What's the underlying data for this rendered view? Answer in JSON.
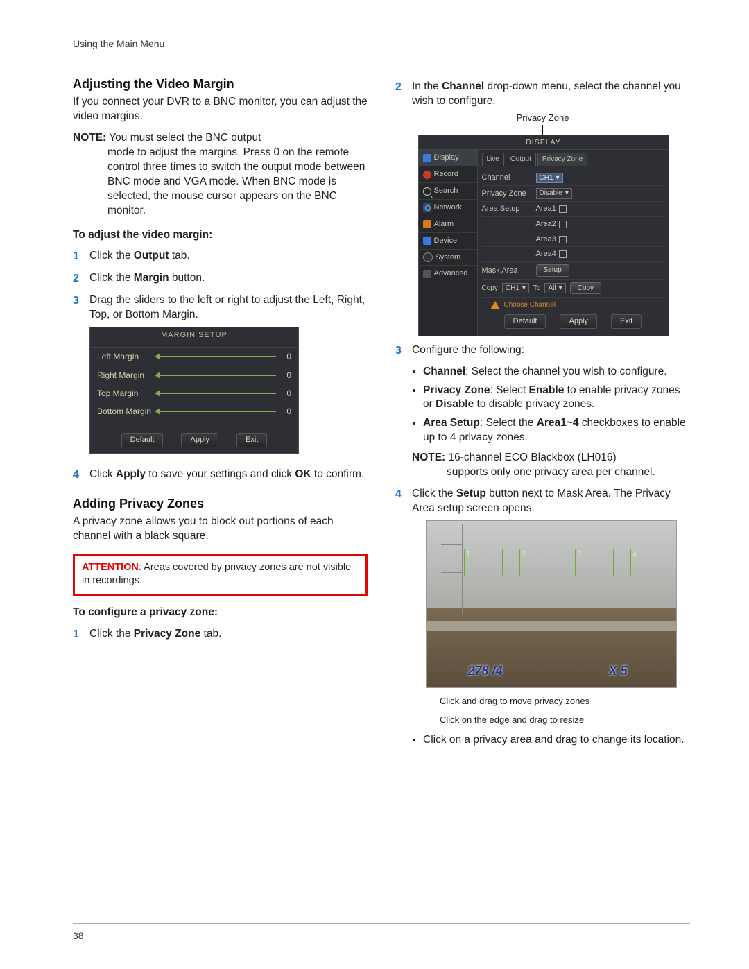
{
  "header": "Using the Main Menu",
  "page_number": "38",
  "left": {
    "h1": "Adjusting the Video Margin",
    "p1": "If you connect your DVR to a BNC monitor, you can adjust the video margins.",
    "note_label": "NOTE:",
    "note_first": " You must select the BNC output",
    "note_rest": "mode to adjust the margins. Press 0 on the remote control three times to switch the output mode between BNC mode and VGA mode. When BNC mode is selected, the mouse cursor appears on the BNC monitor.",
    "sub1": "To adjust the video margin:",
    "s1_a": "Click the ",
    "s1_b": "Output",
    "s1_c": " tab.",
    "s2_a": "Click the ",
    "s2_b": "Margin",
    "s2_c": " button.",
    "s3": "Drag the sliders to the left or right to adjust the Left, Right, Top, or Bottom Margin.",
    "margin_ui": {
      "title": "MARGIN SETUP",
      "rows": [
        {
          "label": "Left Margin",
          "val": "0"
        },
        {
          "label": "Right Margin",
          "val": "0"
        },
        {
          "label": "Top Margin",
          "val": "0"
        },
        {
          "label": "Bottom Margin",
          "val": "0"
        }
      ],
      "btn_default": "Default",
      "btn_apply": "Apply",
      "btn_exit": "Exit"
    },
    "s4_a": "Click ",
    "s4_b": "Apply",
    "s4_c": " to save your settings and click ",
    "s4_d": "OK",
    "s4_e": " to confirm.",
    "h2": "Adding Privacy Zones",
    "p2": "A privacy zone allows you to block out portions of each channel with a black square.",
    "att_label": "ATTENTION",
    "att_text": ": Areas covered by privacy zones are not visible in recordings.",
    "sub2": "To configure a privacy zone:",
    "pz_s1_a": "Click the ",
    "pz_s1_b": "Privacy Zone",
    "pz_s1_c": " tab."
  },
  "right": {
    "s2_a": "In the ",
    "s2_b": "Channel",
    "s2_c": " drop-down menu, select the channel you wish to configure.",
    "pz_caption": "Privacy Zone",
    "pz_ui": {
      "title": "DISPLAY",
      "side": [
        "Display",
        "Record",
        "Search",
        "Network",
        "Alarm",
        "Device",
        "System",
        "Advanced"
      ],
      "tabs": [
        "Live",
        "Output",
        "Privacy Zone"
      ],
      "rows": {
        "channel_lab": "Channel",
        "channel_val": "CH1",
        "pz_lab": "Privacy Zone",
        "pz_val": "Disable",
        "area_lab": "Area Setup",
        "areas": [
          "Area1",
          "Area2",
          "Area3",
          "Area4"
        ],
        "mask_lab": "Mask Area",
        "setup": "Setup"
      },
      "copy": {
        "copy": "Copy",
        "ch": "CH1",
        "to": "To",
        "all": "All",
        "btn": "Copy"
      },
      "warn": "Choose Channel",
      "btn_default": "Default",
      "btn_apply": "Apply",
      "btn_exit": "Exit"
    },
    "s3": "Configure the following:",
    "b1_a": "Channel",
    "b1_b": ": Select the channel you wish to configure.",
    "b2_a": "Privacy Zone",
    "b2_b": ": Select ",
    "b2_c": "Enable",
    "b2_d": " to enable privacy zones or ",
    "b2_e": "Disable",
    "b2_f": " to disable privacy zones.",
    "b3_a": "Area Setup",
    "b3_b": ": Select the ",
    "b3_c": "Area1~4",
    "b3_d": " checkboxes to enable up to 4 privacy zones.",
    "note2_label": "NOTE:",
    "note2_first": " 16-channel ECO Blackbox (LH016)",
    "note2_rest": "supports only one privacy area per channel.",
    "s4_a": "Click the ",
    "s4_b": "Setup",
    "s4_c": " button next to Mask Area. The Privacy Area setup screen opens.",
    "cam": {
      "zones": [
        "1",
        "2",
        "3",
        "4"
      ],
      "wm_left": "278 /4",
      "wm_right": "X 5"
    },
    "cam_cap1": "Click and drag to move privacy zones",
    "cam_cap2": "Click on the edge and drag to resize",
    "b4": "Click on a privacy area and drag to change its location."
  }
}
